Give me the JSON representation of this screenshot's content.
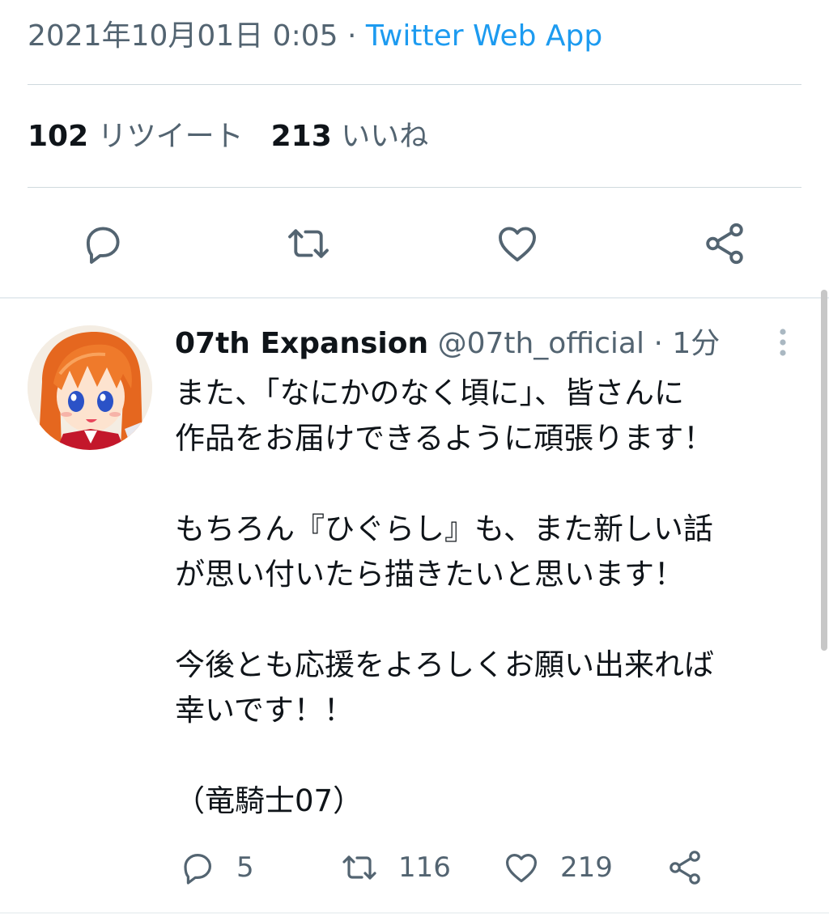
{
  "tweet_meta": {
    "datetime": "2021年10月01日 0:05",
    "separator": " · ",
    "source": "Twitter Web App"
  },
  "stats": {
    "retweets_count": "102",
    "retweets_label": "リツイート",
    "likes_count": "213",
    "likes_label": "いいね"
  },
  "reply": {
    "author_name": "07th Expansion",
    "author_handle": "@07th_official",
    "time_separator": " · ",
    "time_ago": "1分",
    "text": "また、「なにかのなく頃に」、皆さんに\n作品をお届けできるように頑張ります！\n\nもちろん『ひぐらし』も、また新しい話\nが思い付いたら描きたいと思います！\n\n今後とも応援をよろしくお願い出来れば\n幸いです！！\n\n（竜騎士07）",
    "reply_count": "5",
    "retweet_count": "116",
    "like_count": "219"
  },
  "icons": {
    "reply": "reply-icon",
    "retweet": "retweet-icon",
    "like": "heart-icon",
    "share": "share-icon",
    "more": "more-vertical-icon"
  },
  "colors": {
    "link": "#1d9bf0",
    "secondary_text": "#536471",
    "icon": "#536471",
    "divider": "#cfd9de"
  }
}
